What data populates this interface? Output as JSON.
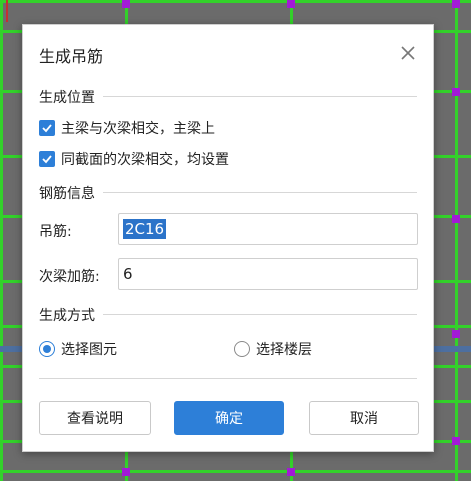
{
  "dialog": {
    "title": "生成吊筋",
    "close_icon": "close-icon"
  },
  "position_section": {
    "label": "生成位置",
    "options": [
      {
        "label": "主梁与次梁相交，主梁上",
        "checked": true
      },
      {
        "label": "同截面的次梁相交，均设置",
        "checked": true
      }
    ]
  },
  "rebar_section": {
    "label": "钢筋信息",
    "hanger_label": "吊筋:",
    "hanger_value": "2C16",
    "secondary_label": "次梁加筋:",
    "secondary_value": "6"
  },
  "method_section": {
    "label": "生成方式",
    "options": [
      {
        "label": "选择图元",
        "selected": true
      },
      {
        "label": "选择楼层",
        "selected": false
      }
    ]
  },
  "buttons": {
    "help": "查看说明",
    "ok": "确定",
    "cancel": "取消"
  },
  "colors": {
    "accent": "#2d7fd8",
    "grid_green": "#33d12a",
    "node_purple": "#a21ad6",
    "canvas_gray": "#6b6b6b"
  }
}
